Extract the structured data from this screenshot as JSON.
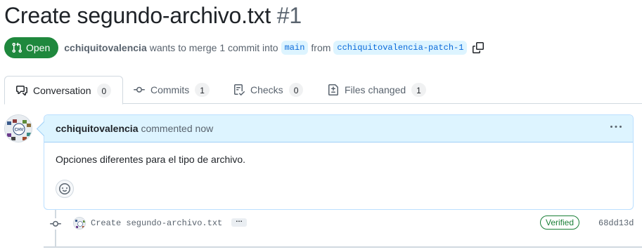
{
  "pr": {
    "title": "Create segundo-archivo.txt",
    "number": "#1",
    "state": "Open",
    "author": "cchiquitovalencia",
    "merge_text": "wants to merge 1 commit into",
    "base_branch": "main",
    "from_text": "from",
    "head_branch": "cchiquitovalencia-patch-1"
  },
  "tabs": [
    {
      "label": "Conversation",
      "count": "0",
      "icon": "comment-discussion-icon"
    },
    {
      "label": "Commits",
      "count": "1",
      "icon": "git-commit-icon"
    },
    {
      "label": "Checks",
      "count": "0",
      "icon": "checklist-icon"
    },
    {
      "label": "Files changed",
      "count": "1",
      "icon": "file-diff-icon"
    }
  ],
  "comment": {
    "author": "cchiquitovalencia",
    "action": "commented",
    "time": "now",
    "body": "Opciones diferentes para el tipo de archivo.",
    "avatar_text": "CHV"
  },
  "commit": {
    "message": "Create segundo-archivo.txt",
    "verified_label": "Verified",
    "sha": "68dd13d"
  },
  "colors": {
    "open_green": "#1f883d",
    "link_blue": "#0969da",
    "comment_header_bg": "#ddf4ff",
    "verified_green": "#1a7f37"
  }
}
